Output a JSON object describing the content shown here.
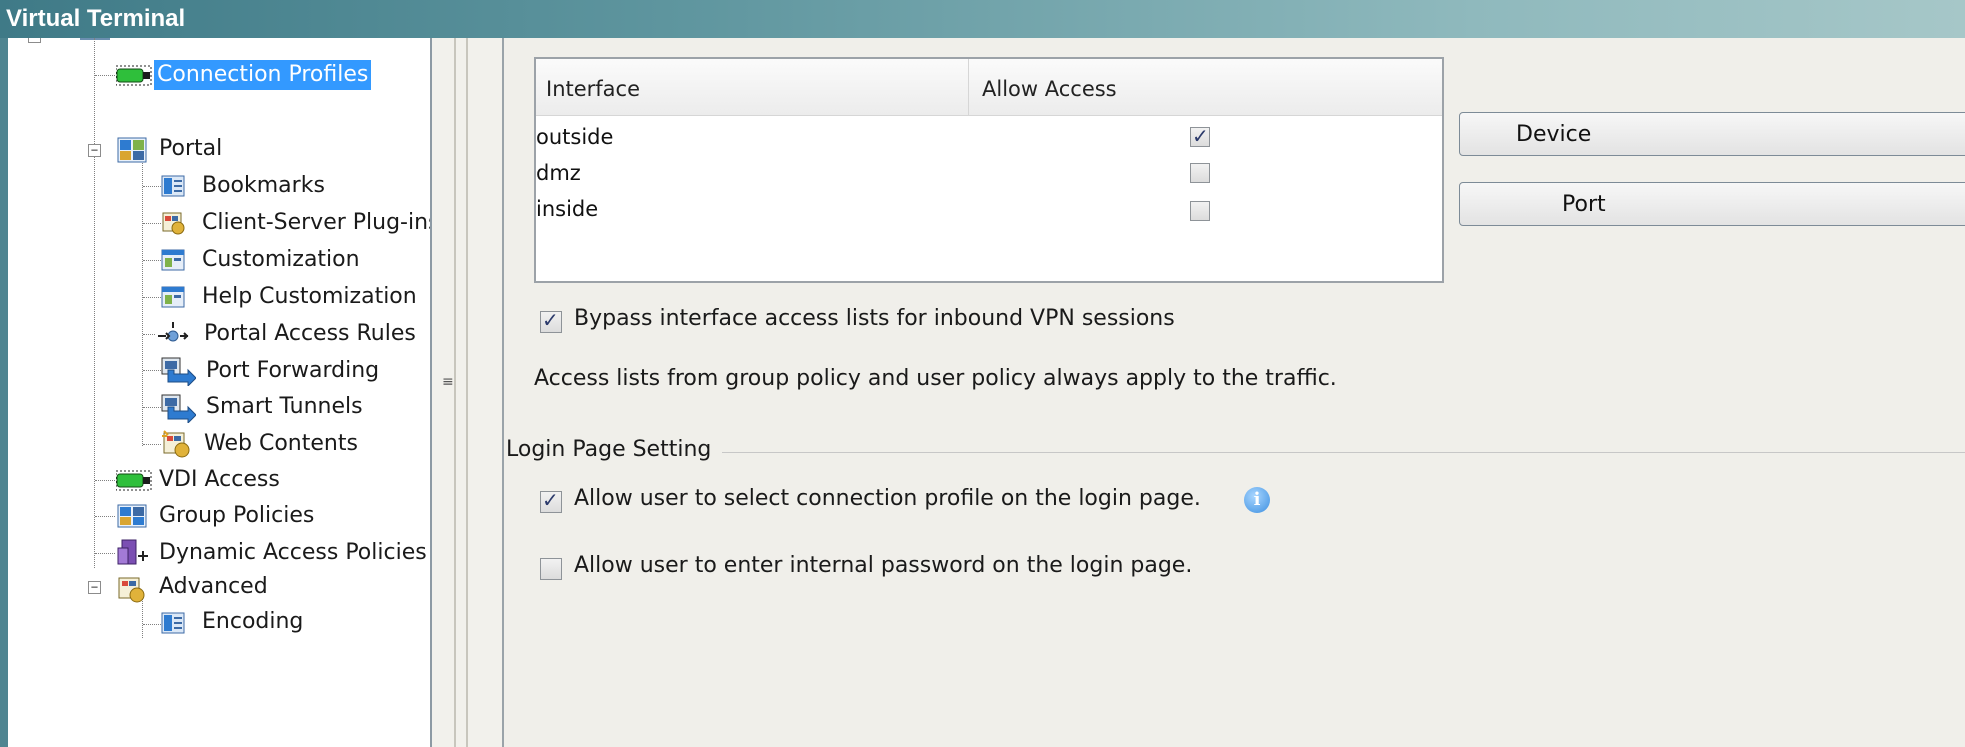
{
  "window": {
    "title": "Virtual Terminal"
  },
  "tree": {
    "items": [
      {
        "label": "Connection Profiles",
        "icon": "connection-profile-icon",
        "selected": true
      },
      {
        "label": "Portal",
        "icon": "portal-icon",
        "expanded": true
      },
      {
        "label": "Bookmarks",
        "icon": "bookmarks-icon"
      },
      {
        "label": "Client-Server Plug-ins",
        "icon": "plugin-icon"
      },
      {
        "label": "Customization",
        "icon": "customization-icon"
      },
      {
        "label": "Help Customization",
        "icon": "help-customization-icon"
      },
      {
        "label": "Portal Access Rules",
        "icon": "access-rules-icon"
      },
      {
        "label": "Port Forwarding",
        "icon": "port-forwarding-icon"
      },
      {
        "label": "Smart Tunnels",
        "icon": "smart-tunnels-icon"
      },
      {
        "label": "Web Contents",
        "icon": "web-contents-icon"
      },
      {
        "label": "VDI Access",
        "icon": "vdi-access-icon"
      },
      {
        "label": "Group Policies",
        "icon": "group-policies-icon"
      },
      {
        "label": "Dynamic Access Policies",
        "icon": "dynamic-access-icon"
      },
      {
        "label": "Advanced",
        "icon": "advanced-icon",
        "expanded": true
      },
      {
        "label": "Encoding",
        "icon": "encoding-icon"
      }
    ]
  },
  "interfaces_table": {
    "headers": [
      "Interface",
      "Allow Access"
    ],
    "rows": [
      {
        "interface": "outside",
        "allow_access": true
      },
      {
        "interface": "dmz",
        "allow_access": false
      },
      {
        "interface": "inside",
        "allow_access": false
      }
    ]
  },
  "buttons": {
    "device": "Device",
    "port": "Port"
  },
  "bypass": {
    "label": "Bypass interface access lists for inbound VPN sessions",
    "checked": true
  },
  "access_note": "Access lists from group policy and user policy always apply to the traffic.",
  "login_group": {
    "title": "Login Page Setting",
    "allow_select_profile": {
      "label": "Allow user to select connection profile on the login page.",
      "checked": true
    },
    "allow_internal_password": {
      "label": "Allow user to enter internal password on the login page.",
      "checked": false
    }
  },
  "colors": {
    "titlebar": "#3f7a87",
    "selection": "#3399ff",
    "panel": "#f0efea"
  }
}
